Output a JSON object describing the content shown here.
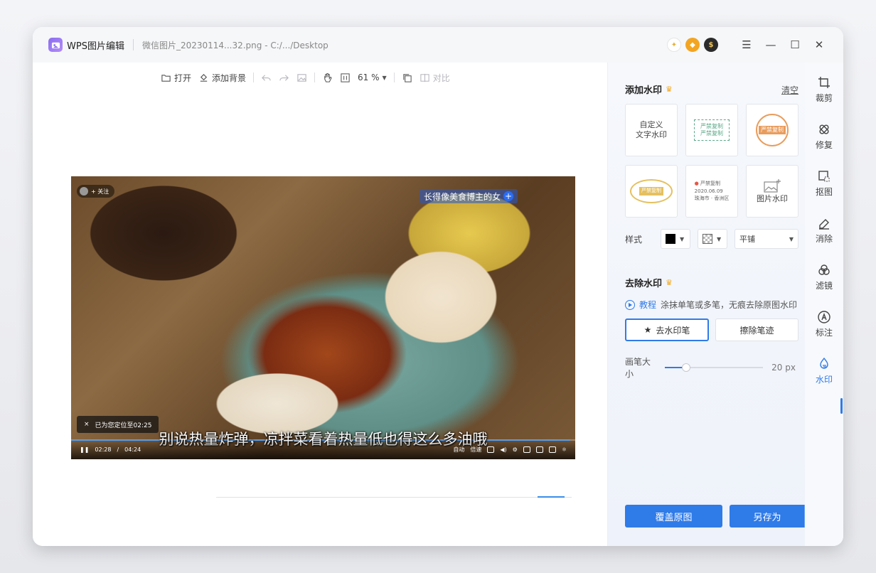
{
  "window": {
    "app_name": "WPS图片编辑",
    "file_title": "微信图片_20230114...32.png - C:/.../Desktop"
  },
  "toolbar": {
    "open_label": "打开",
    "add_bg_label": "添加背景",
    "zoom": "61 %",
    "compare_label": "对比"
  },
  "image": {
    "follow_label": "+ 关注",
    "blogger_label": "长得像美食博主的女",
    "toast_close": "×",
    "toast_text": "已为您定位至02:25",
    "subtitle": "别说热量炸弹，凉拌菜看着热量低也得这么多油哦",
    "time_current": "02:28",
    "time_sep": "/",
    "time_total": "04:24",
    "ctrl_auto": "自动",
    "ctrl_speed": "倍速"
  },
  "add_watermark": {
    "title": "添加水印",
    "clear_label": "清空",
    "tiles": {
      "custom_text": "自定义\n文字水印",
      "stamp_rect_line1": "严禁复制",
      "stamp_rect_line2": "严禁复制",
      "stamp_round": "严禁复制",
      "stamp_oval": "严禁复制",
      "location_title": "严禁复制",
      "location_date": "2020.06.09",
      "location_place": "珠海市 · 香洲区",
      "image_wm": "图片水印"
    },
    "style_label": "样式",
    "tile_mode": "平铺"
  },
  "remove_watermark": {
    "title": "去除水印",
    "tutorial_label": "教程",
    "hint": "涂抹单笔或多笔，无痕去除原图水印",
    "remove_brush_label": "去水印笔",
    "erase_trace_label": "擦除笔迹",
    "brush_size_label": "画笔大小",
    "brush_size_value": "20",
    "brush_size_unit": "px",
    "brush_size_fraction": 0.22
  },
  "actions": {
    "overwrite_label": "覆盖原图",
    "save_as_label": "另存为"
  },
  "rail": {
    "crop": "裁剪",
    "repair": "修复",
    "cutout": "抠图",
    "erase": "消除",
    "filter": "滤镜",
    "annotate": "标注",
    "watermark": "水印"
  },
  "colors": {
    "accent": "#2f7be8",
    "crown": "#f2a81d"
  }
}
